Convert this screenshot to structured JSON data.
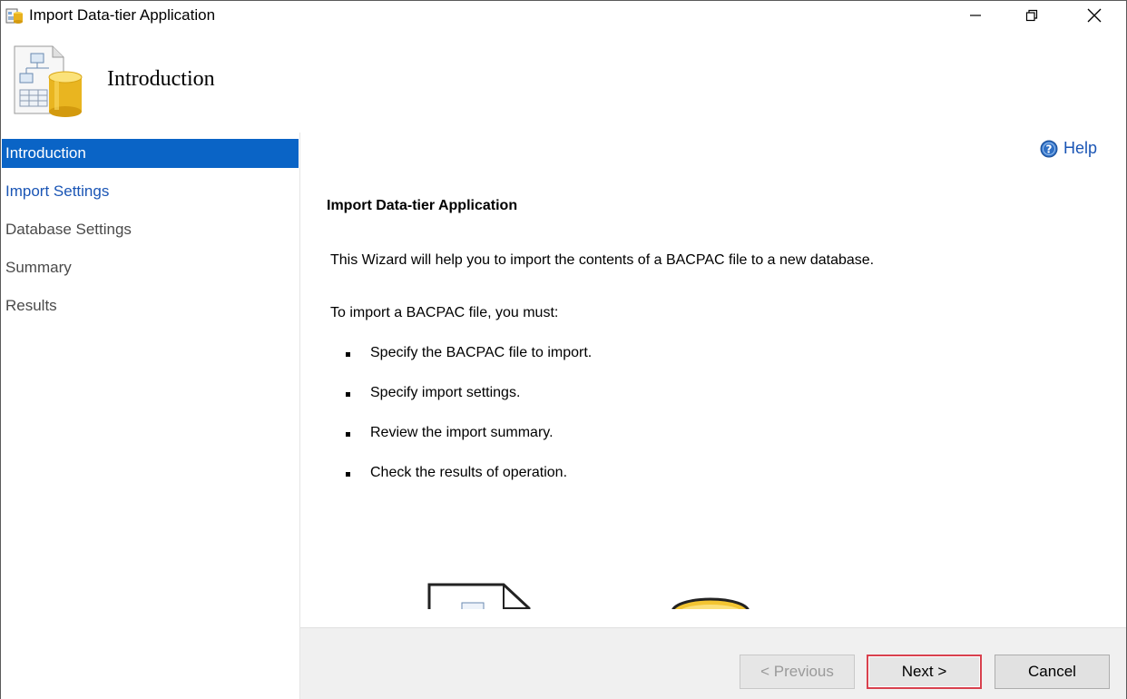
{
  "window": {
    "title": "Import Data-tier Application"
  },
  "header": {
    "title": "Introduction"
  },
  "nav": {
    "items": [
      {
        "label": "Introduction",
        "state": "active"
      },
      {
        "label": "Import Settings",
        "state": "link"
      },
      {
        "label": "Database Settings",
        "state": "disabled"
      },
      {
        "label": "Summary",
        "state": "disabled"
      },
      {
        "label": "Results",
        "state": "disabled"
      }
    ]
  },
  "content": {
    "help_label": "Help",
    "section_title": "Import Data-tier Application",
    "intro_text": "This Wizard will help you to import the contents of a BACPAC file to a new database.",
    "must_text": "To import a BACPAC file, you must:",
    "steps": [
      "Specify the BACPAC file to import.",
      "Specify import settings.",
      "Review the import summary.",
      "Check the results of operation."
    ]
  },
  "footer": {
    "previous_label": "< Previous",
    "next_label": "Next >",
    "cancel_label": "Cancel"
  },
  "colors": {
    "nav_active_bg": "#0a64c6",
    "link": "#1a55b5",
    "next_highlight": "#d9414e"
  },
  "icons": [
    "app-icon",
    "minimize-icon",
    "restore-icon",
    "close-icon",
    "database-wizard-icon",
    "help-icon"
  ]
}
